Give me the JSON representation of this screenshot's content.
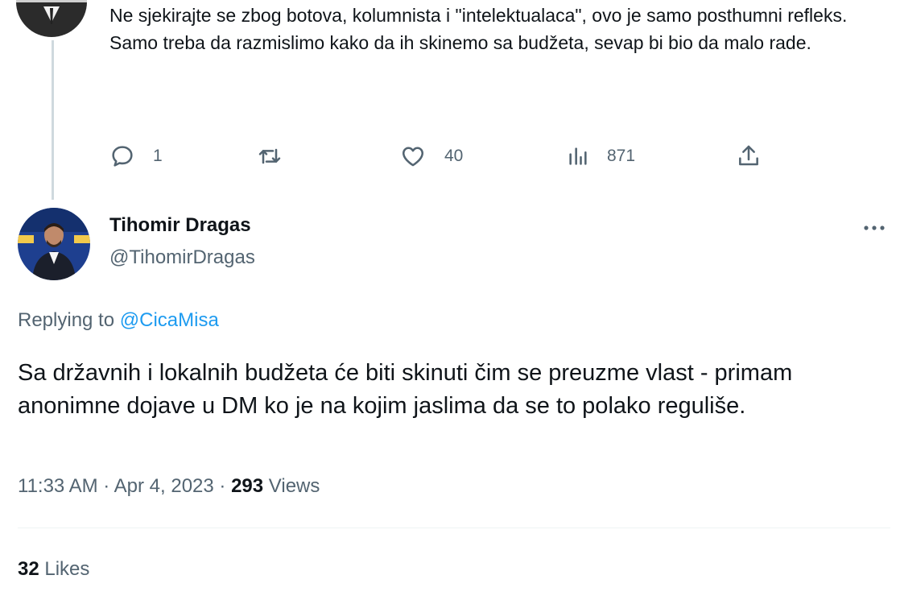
{
  "parent_tweet": {
    "text_lines": [
      "Ne sjekirajte se zbog botova, kolumnista i \"intelektualaca\", ovo je samo posthumni refleks.",
      "Samo treba da razmislimo kako da ih skinemo sa budžeta, sevap bi bio da malo rade."
    ],
    "actions": {
      "replies": "1",
      "retweets": "",
      "likes": "40",
      "views": "871"
    }
  },
  "reply_tweet": {
    "author_name": "Tihomir Dragas",
    "author_handle": "@TihomirDragas",
    "replying_prefix": "Replying to",
    "replying_to": "@CicaMisa",
    "text": "Sa državnih i lokalnih budžeta će biti skinuti čim se preuzme vlast - primam anonimne dojave u DM ko je na kojim jaslima da se to polako reguliše.",
    "time": "11:33 AM",
    "date": "Apr 4, 2023",
    "separator": "·",
    "views_count": "293",
    "views_label": "Views",
    "likes_count": "32",
    "likes_label": "Likes"
  },
  "icons": {
    "reply": "speech-bubble-icon",
    "retweet": "retweet-icon",
    "like": "heart-icon",
    "views": "bar-chart-icon",
    "share": "share-icon",
    "more": "ellipsis-icon"
  },
  "colors": {
    "text_primary": "#0f1419",
    "text_secondary": "#536471",
    "link": "#1d9bf0",
    "thread_line": "#cfd9de"
  }
}
